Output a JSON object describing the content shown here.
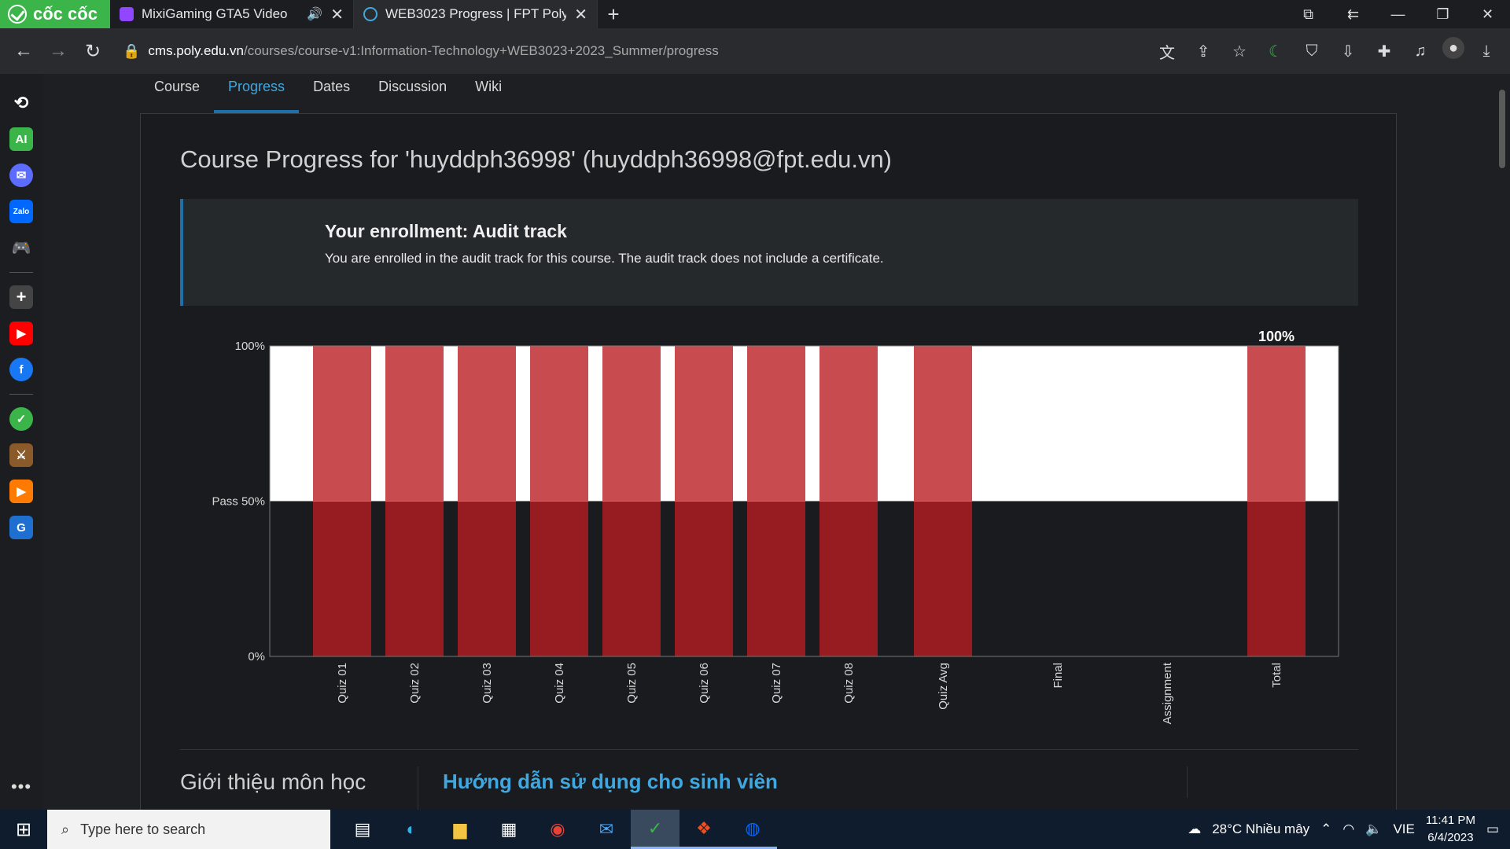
{
  "browser": {
    "brand": "cốc cốc",
    "tabs": [
      {
        "title": "MixiGaming GTA5 Video",
        "active": false,
        "audio": true,
        "favicon_color": "#9146ff"
      },
      {
        "title": "WEB3023 Progress | FPT Poly",
        "active": true,
        "audio": false,
        "favicon_color": "#1f6fa8"
      }
    ],
    "url_host": "cms.poly.edu.vn",
    "url_path": "/courses/course-v1:Information-Technology+WEB3023+2023_Summer/progress"
  },
  "sidebar": {
    "items": [
      "history-icon",
      "ai-icon",
      "messenger-icon",
      "zalo-icon",
      "game-icon",
      "add-icon",
      "youtube-icon",
      "facebook-icon",
      "coccoc-app-icon",
      "game-avatar-icon",
      "media-icon",
      "grammarly-icon"
    ],
    "ai_label": "AI"
  },
  "course_tabs": [
    "Course",
    "Progress",
    "Dates",
    "Discussion",
    "Wiki"
  ],
  "active_course_tab": "Progress",
  "page": {
    "title": "Course Progress for 'huyddph36998' (huyddph36998@fpt.edu.vn)",
    "enrollment": {
      "heading": "Your enrollment: Audit track",
      "text": "You are enrolled in the audit track for this course. The audit track does not include a certificate."
    },
    "intro_heading": "Giới thiệu môn học",
    "guide_heading": "Hướng dẫn sử dụng cho sinh viên"
  },
  "chart_data": {
    "type": "bar",
    "categories": [
      "Quiz 01",
      "Quiz 02",
      "Quiz 03",
      "Quiz 04",
      "Quiz 05",
      "Quiz 06",
      "Quiz 07",
      "Quiz 08",
      "Quiz Avg",
      "Final",
      "Assignment",
      "Total"
    ],
    "values": [
      100,
      100,
      100,
      100,
      100,
      100,
      100,
      100,
      100,
      0,
      0,
      100
    ],
    "y_ticks": [
      "100%",
      "Pass 50%",
      "0%"
    ],
    "ylim": [
      0,
      100
    ],
    "pass_threshold": 50,
    "total_label": "100%",
    "colors": {
      "bar_upper": "#c84c4f",
      "bar_lower": "#961c22",
      "upper_band": "#ffffff",
      "lower_band": "#1a1b1e"
    }
  },
  "taskbar": {
    "search_placeholder": "Type here to search",
    "apps": [
      "task-view-icon",
      "edge-icon",
      "file-explorer-icon",
      "store-icon",
      "chrome-icon",
      "mail-icon",
      "coccoc-icon",
      "figma-icon",
      "zalo-icon"
    ],
    "active_app": "coccoc-icon",
    "weather": "28°C  Nhiều mây",
    "language": "VIE",
    "time": "11:41 PM",
    "date": "6/4/2023"
  }
}
